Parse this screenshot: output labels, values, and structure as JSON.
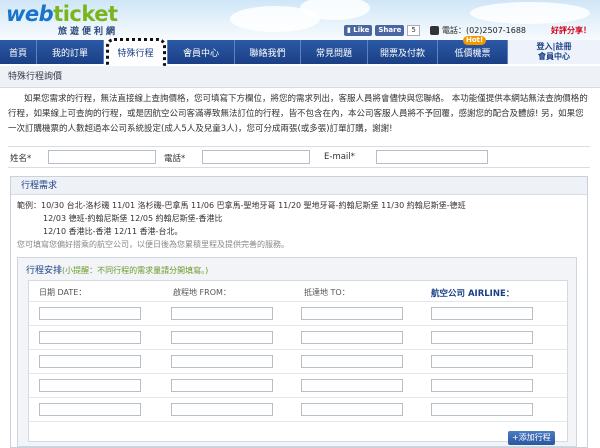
{
  "header": {
    "logo_web": "web",
    "logo_ticket": "ticket",
    "logo_sub": "旅遊便利網",
    "fb_like": "Like",
    "fb_share": "Share",
    "fb_count": "5",
    "phone": "電話：(02)2507-1688",
    "share_text": "好評分享！"
  },
  "nav": {
    "items": [
      "首頁",
      "我的訂單",
      "特殊行程",
      "會員中心",
      "聯絡我們",
      "常見問題",
      "開票及付款",
      "低價機票"
    ],
    "hot": "Hot!",
    "login": "登入|註冊",
    "member": "會員中心"
  },
  "section_title": "特殊行程詢價",
  "intro": {
    "text1": "如果您需求的行程，無法直接線上查詢價格，您可填寫下方欄位，將您的需求列出，客服人員將會儘快與您聯絡。 本功能僅提供本網站無法查詢價格的行程，如果線上可查詢的行程，或是因航空公司客滿導致無法訂位的行程，皆不包含在內，本公司客服人員將不予回覆，感謝您的配合及體諒! 另，如果您一次訂購機票的人數超過本公司系統設定(成人5人及兒童3人)，您可分成兩張(或多張)訂單訂購，謝謝!"
  },
  "contact": {
    "name_label": "姓名*",
    "phone_label": "電話*",
    "email_label": "E-mail*"
  },
  "request": {
    "title": "行程需求",
    "example_line1": "範例：10/30 台北-洛杉磯 11/01 洛杉磯-巴拿馬 11/06 巴拿馬-聖地牙哥 11/20 聖地牙哥-約翰尼斯堡 11/30 約翰尼斯堡-德班",
    "example_line2": "12/03 德班-約翰尼斯堡 12/05 約翰尼斯堡-香港比",
    "example_line3": "12/10 香港比-香港 12/11 香港-台北。",
    "example_note": "您可填寫您偏好搭乘的航空公司，以便日後為您累積里程及提供完善的服務。"
  },
  "itinerary": {
    "title": "行程安排",
    "tip": "(小提醒：不同行程的需求量請分開填寫。)",
    "col_date": "日期 DATE：",
    "col_from": "啟程地 FROM：",
    "col_to": "抵達地 TO：",
    "col_airline": "航空公司 AIRLINE：",
    "add_button": "+添加行程"
  }
}
